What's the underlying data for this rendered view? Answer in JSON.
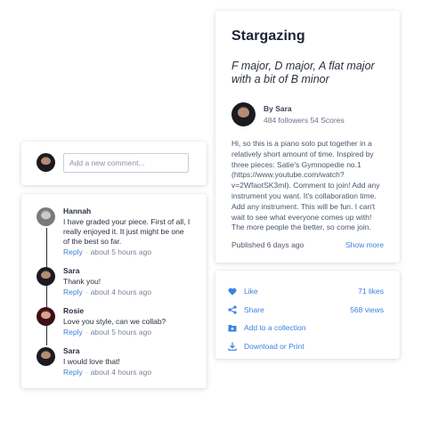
{
  "score": {
    "title": "Stargazing",
    "subtitle": "F major, D major, A flat major with a bit of B minor",
    "author_name": "By Sara",
    "author_stats": "484 followers 54 Scores",
    "description": "Hi, so this is a piano solo put together in a relatively short amount of time. Inspired by three pieces: Satie's Gymnopedie no.1 (https://www.youtube.com/watch?v=2WfaotSK3mI). Comment to join! Add any instrument you want. It's collaboration time. Add any instrument. This will be fun. I can't wait to see what everyone comes up with! The more people the better, so come join.",
    "published": "Published 6 days ago",
    "show_more": "Show more"
  },
  "actions": {
    "like_label": "Like",
    "like_count": "71 likes",
    "share_label": "Share",
    "share_count": "568 views",
    "collection_label": "Add to a collection",
    "download_label": "Download or Print"
  },
  "new_comment": {
    "placeholder": "Add a new comment..."
  },
  "comments": [
    {
      "author": "Hannah",
      "text": "I have graded your piece. First of all, I really enjoyed it. It just might be one of the best so far.",
      "reply": "Reply",
      "time": "about 5 hours ago"
    },
    {
      "author": "Sara",
      "text": "Thank you!",
      "reply": "Reply",
      "time": "about 4 hours ago"
    },
    {
      "author": "Rosie",
      "text": "Love you style, can we collab?",
      "reply": "Reply",
      "time": "about 5 hours ago"
    },
    {
      "author": "Sara",
      "text": "I would love that!",
      "reply": "Reply",
      "time": "about 4 hours ago"
    }
  ],
  "colors": {
    "accent": "#3b83e0",
    "text_dark": "#1d2235",
    "text_muted": "#49566f"
  }
}
